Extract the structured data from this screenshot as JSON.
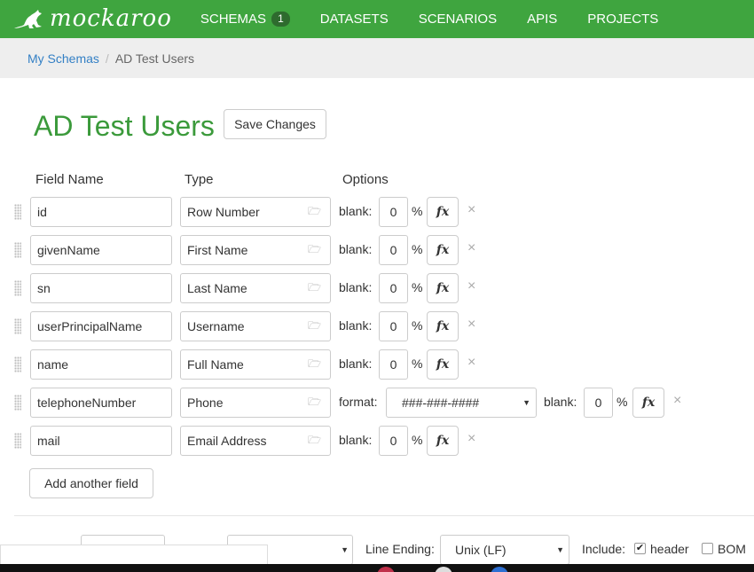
{
  "brand": {
    "name": "mockaroo"
  },
  "nav": [
    {
      "label": "SCHEMAS",
      "badge": "1"
    },
    {
      "label": "DATASETS"
    },
    {
      "label": "SCENARIOS"
    },
    {
      "label": "APIS"
    },
    {
      "label": "PROJECTS"
    }
  ],
  "breadcrumb": {
    "link": "My Schemas",
    "separator": "/",
    "current": "AD Test Users"
  },
  "page": {
    "title": "AD Test Users",
    "save_label": "Save Changes"
  },
  "columns": {
    "field_name": "Field Name",
    "type": "Type",
    "options": "Options"
  },
  "fields": [
    {
      "name": "id",
      "type": "Row Number",
      "blank_label": "blank:",
      "blank": "0",
      "pct": "%"
    },
    {
      "name": "givenName",
      "type": "First Name",
      "blank_label": "blank:",
      "blank": "0",
      "pct": "%"
    },
    {
      "name": "sn",
      "type": "Last Name",
      "blank_label": "blank:",
      "blank": "0",
      "pct": "%"
    },
    {
      "name": "userPrincipalName",
      "type": "Username",
      "blank_label": "blank:",
      "blank": "0",
      "pct": "%"
    },
    {
      "name": "name",
      "type": "Full Name",
      "blank_label": "blank:",
      "blank": "0",
      "pct": "%"
    },
    {
      "name": "telephoneNumber",
      "type": "Phone",
      "format_label": "format:",
      "format": "###-###-####",
      "blank_label": "blank:",
      "blank": "0",
      "pct": "%"
    },
    {
      "name": "mail",
      "type": "Email Address",
      "blank_label": "blank:",
      "blank": "0",
      "pct": "%"
    }
  ],
  "fx_label": "fx",
  "delete_glyph": "×",
  "add_field_label": "Add another field",
  "footer": {
    "line_ending_label": "Line Ending:",
    "line_ending": "Unix (LF)",
    "include_label": "Include:",
    "header_label": "header",
    "header_checked": true,
    "bom_label": "BOM",
    "bom_checked": false
  },
  "colors": {
    "brand_green": "#3fa53f",
    "title_green": "#3b9a3b",
    "link_blue": "#3480c5"
  }
}
